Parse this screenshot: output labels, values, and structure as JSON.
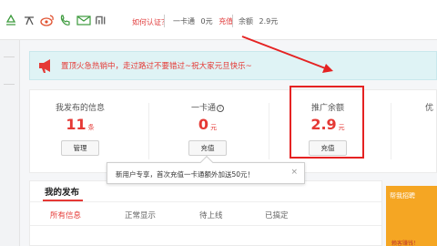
{
  "topbar": {
    "social_icons": [
      "recycle-icon",
      "text-icon",
      "weibo-icon",
      "phone-icon",
      "mail-icon",
      "xiaomi-icon"
    ],
    "verify_link": "如何认证？",
    "card_label": "一卡通",
    "card_value": "0元",
    "card_action": "充值",
    "balance_label": "余额",
    "balance_value": "2.9元"
  },
  "notice": {
    "text": "置顶火急热销中，走过路过不要错过~祝大家元旦快乐~"
  },
  "stats": [
    {
      "label": "我发布的信息",
      "value": "11",
      "unit": "条",
      "button": "管理"
    },
    {
      "label": "一卡通",
      "value": "0",
      "unit": "元",
      "button": "充值",
      "info_icon": "i"
    },
    {
      "label": "推广余额",
      "value": "2.9",
      "unit": "元",
      "button": "充值"
    },
    {
      "label": "优",
      "value": "",
      "unit": "",
      "button": ""
    }
  ],
  "tooltip": {
    "text": "新用户专享，首次充值一卡通额外加送50元！",
    "close": "×"
  },
  "posts": {
    "title": "我的发布",
    "tabs": [
      "所有信息",
      "正常显示",
      "待上线",
      "已搞定"
    ]
  },
  "promo": {
    "top": "帮我招聘",
    "bottom": "赖客赚钱！"
  },
  "colors": {
    "accent": "#e53935",
    "banner_bg": "#dff3f5",
    "highlight": "#e52222",
    "promo": "#f5a623"
  }
}
